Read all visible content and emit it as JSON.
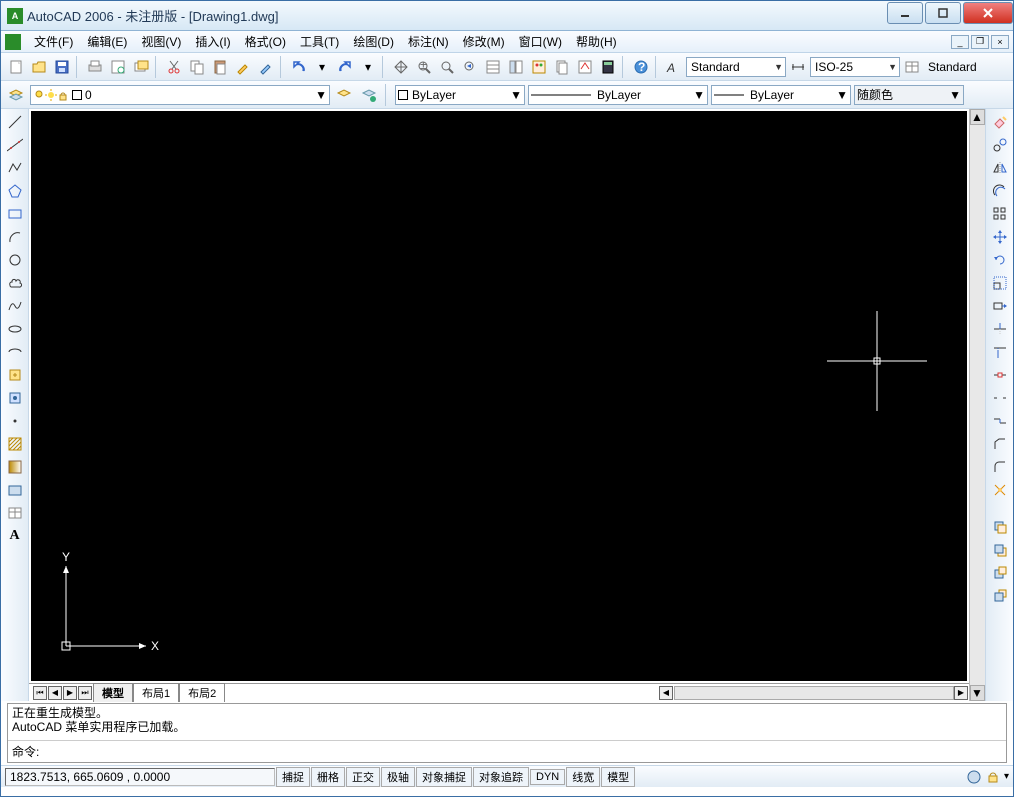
{
  "title": "AutoCAD 2006 - 未注册版 - [Drawing1.dwg]",
  "menu": [
    "文件(F)",
    "编辑(E)",
    "视图(V)",
    "插入(I)",
    "格式(O)",
    "工具(T)",
    "绘图(D)",
    "标注(N)",
    "修改(M)",
    "窗口(W)",
    "帮助(H)"
  ],
  "std_toolbar": {
    "textstyle": "Standard",
    "dimstyle": "ISO-25",
    "tablestyle": "Standard"
  },
  "layer": {
    "current": "0",
    "color_dd": "ByLayer",
    "ltype_dd": "ByLayer",
    "lweight_dd": "ByLayer",
    "plot_dd": "随颜色"
  },
  "ucs": {
    "x": "X",
    "y": "Y"
  },
  "tabs": {
    "model": "模型",
    "layout1": "布局1",
    "layout2": "布局2"
  },
  "command": {
    "line1": "正在重生成模型。",
    "line2": "AutoCAD 菜单实用程序已加载。",
    "prompt": "命令:"
  },
  "status": {
    "coords": "1823.7513, 665.0609 , 0.0000",
    "toggles": [
      "捕捉",
      "栅格",
      "正交",
      "极轴",
      "对象捕捉",
      "对象追踪",
      "DYN",
      "线宽",
      "模型"
    ]
  }
}
